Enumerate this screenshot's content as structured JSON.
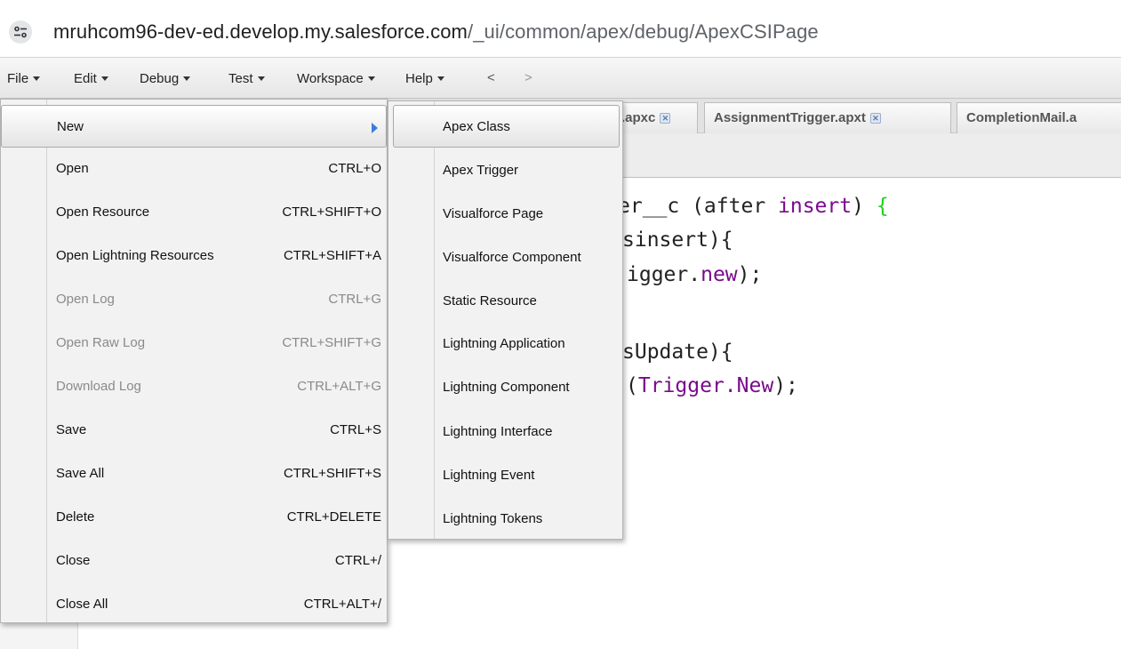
{
  "browser": {
    "url_host": "mruhcom96-dev-ed.develop.my.salesforce.com",
    "url_path": "/_ui/common/apex/debug/ApexCSIPage",
    "site_icon": "site-settings-icon"
  },
  "menubar": {
    "items": [
      {
        "label": "File"
      },
      {
        "label": "Edit"
      },
      {
        "label": "Debug"
      },
      {
        "label": "Test"
      },
      {
        "label": "Workspace"
      },
      {
        "label": "Help"
      }
    ],
    "back": "<",
    "forward": ">"
  },
  "tabs": [
    {
      "label": ".apxc",
      "close": "close-tab-icon"
    },
    {
      "label": "AssignmentTrigger.apxt",
      "close": "close-tab-icon"
    },
    {
      "label": "CompletionMail.a",
      "close": "close-tab-icon"
    }
  ],
  "code_lines": [
    {
      "pre": "er__c (after ",
      "kw": "insert",
      "post": ") ",
      "brace": "{"
    },
    {
      "pre": "sinsert){",
      "kw": "",
      "post": "",
      "brace": ""
    },
    {
      "pre": "igger.",
      "kw": "new",
      "post": ");",
      "brace": ""
    },
    {
      "pre": "sUpdate){",
      "kw": "",
      "post": "",
      "brace": ""
    },
    {
      "pre": "(",
      "kw": "Trigger.New",
      "post": ");",
      "brace": ""
    }
  ],
  "file_menu": {
    "items": [
      {
        "label": "New",
        "shortcut": "",
        "disabled": false,
        "submenu": true,
        "highlighted": true
      },
      {
        "label": "Open",
        "shortcut": "CTRL+O",
        "disabled": false
      },
      {
        "label": "Open Resource",
        "shortcut": "CTRL+SHIFT+O",
        "disabled": false
      },
      {
        "label": "Open Lightning Resources",
        "shortcut": "CTRL+SHIFT+A",
        "disabled": false
      },
      {
        "label": "Open Log",
        "shortcut": "CTRL+G",
        "disabled": true
      },
      {
        "label": "Open Raw Log",
        "shortcut": "CTRL+SHIFT+G",
        "disabled": true
      },
      {
        "label": "Download Log",
        "shortcut": "CTRL+ALT+G",
        "disabled": true
      },
      {
        "label": "Save",
        "shortcut": "CTRL+S",
        "disabled": false
      },
      {
        "label": "Save All",
        "shortcut": "CTRL+SHIFT+S",
        "disabled": false
      },
      {
        "label": "Delete",
        "shortcut": "CTRL+DELETE",
        "disabled": false
      },
      {
        "label": "Close",
        "shortcut": "CTRL+/",
        "disabled": false
      },
      {
        "label": "Close All",
        "shortcut": "CTRL+ALT+/",
        "disabled": false
      }
    ]
  },
  "new_submenu": {
    "items": [
      {
        "label": "Apex Class",
        "highlighted": true
      },
      {
        "label": "Apex Trigger"
      },
      {
        "label": "Visualforce Page"
      },
      {
        "label": "Visualforce Component"
      },
      {
        "label": "Static Resource"
      },
      {
        "label": "Lightning Application"
      },
      {
        "label": "Lightning Component"
      },
      {
        "label": "Lightning Interface"
      },
      {
        "label": "Lightning Event"
      },
      {
        "label": "Lightning Tokens"
      }
    ]
  },
  "colors": {
    "keyword": "#7a0a8c",
    "brace": "#1fd11f",
    "submenu_arrow": "#3b7ddd",
    "disabled_text": "#8a8a8a"
  }
}
